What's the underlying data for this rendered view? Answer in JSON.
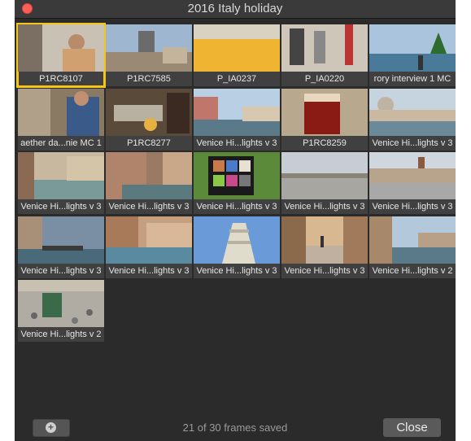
{
  "window": {
    "title": "2016 Italy holiday"
  },
  "frames": [
    {
      "caption": "P1RC8107",
      "selected": true
    },
    {
      "caption": "P1RC7585"
    },
    {
      "caption": "P_IA0237"
    },
    {
      "caption": "P_IA0220"
    },
    {
      "caption": "rory interview 1 MC"
    },
    {
      "caption": "aether da...nie MC 1"
    },
    {
      "caption": "P1RC8277"
    },
    {
      "caption": "Venice Hi...lights v 3"
    },
    {
      "caption": "P1RC8259"
    },
    {
      "caption": "Venice Hi...lights v 3"
    },
    {
      "caption": "Venice Hi...lights v 3"
    },
    {
      "caption": "Venice Hi...lights v 3"
    },
    {
      "caption": "Venice Hi...lights v 3"
    },
    {
      "caption": "Venice Hi...lights v 3"
    },
    {
      "caption": "Venice Hi...lights v 3"
    },
    {
      "caption": "Venice Hi...lights v 3"
    },
    {
      "caption": "Venice Hi...lights v 3"
    },
    {
      "caption": "Venice Hi...lights v 3"
    },
    {
      "caption": "Venice Hi...lights v 3"
    },
    {
      "caption": "Venice Hi...lights v 2"
    },
    {
      "caption": "Venice Hi...lights v 2"
    }
  ],
  "footer": {
    "add_icon": "plus-icon",
    "status": "21 of 30 frames saved",
    "close_label": "Close"
  },
  "colors": {
    "selection": "#f5c518",
    "close_dot": "#ff5f57"
  }
}
